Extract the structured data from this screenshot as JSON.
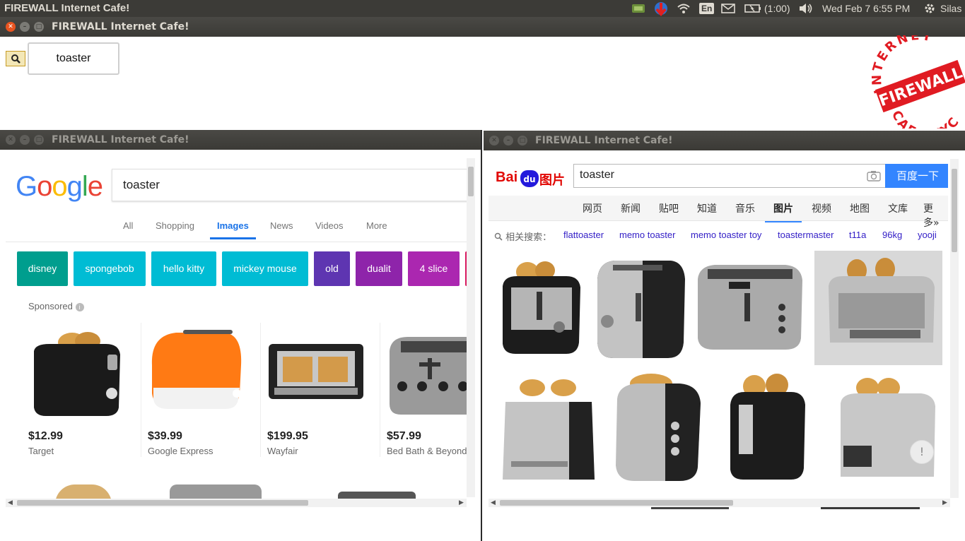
{
  "system_bar": {
    "app_name": "FIREWALL Internet Cafe!",
    "language": "En",
    "battery": "(1:00)",
    "datetime": "Wed Feb  7  6:55 PM",
    "user": "Silas"
  },
  "main_window": {
    "title": "FIREWALL Internet Cafe!",
    "search_value": "toaster",
    "logo_text": {
      "top": "INTERNET",
      "middle": "FIREWALL",
      "bottom": "CAFE NYC"
    }
  },
  "google_window": {
    "title": "FIREWALL Internet Cafe!",
    "search_value": "toaster",
    "tabs": [
      "All",
      "Shopping",
      "Images",
      "News",
      "Videos",
      "More"
    ],
    "active_tab": "Images",
    "chips": [
      {
        "label": "disney",
        "color": "#009e8e"
      },
      {
        "label": "spongebob",
        "color": "#00bcd4"
      },
      {
        "label": "hello kitty",
        "color": "#00bcd4"
      },
      {
        "label": "mickey mouse",
        "color": "#00bcd4"
      },
      {
        "label": "old",
        "color": "#5e35b1"
      },
      {
        "label": "dualit",
        "color": "#8e24aa"
      },
      {
        "label": "4 slice",
        "color": "#ab27b0"
      }
    ],
    "sponsored_label": "Sponsored",
    "products": [
      {
        "price": "$12.99",
        "store": "Target"
      },
      {
        "price": "$39.99",
        "store": "Google Express"
      },
      {
        "price": "$199.95",
        "store": "Wayfair"
      },
      {
        "price": "$57.99",
        "store": "Bed Bath & Beyond"
      }
    ]
  },
  "baidu_window": {
    "title": "FIREWALL Internet Cafe!",
    "logo": {
      "bai": "Bai",
      "du": "du",
      "pic": "图片"
    },
    "search_value": "toaster",
    "search_button": "百度一下",
    "nav": [
      "网页",
      "新闻",
      "贴吧",
      "知道",
      "音乐",
      "图片",
      "视频",
      "地图",
      "文库",
      "更多»"
    ],
    "active_nav": "图片",
    "related_label": "相关搜索：",
    "related": [
      "flattoaster",
      "memo toaster",
      "memo toaster toy",
      "toastermaster",
      "t11a",
      "96kg",
      "yooji"
    ],
    "feedback": "!"
  }
}
